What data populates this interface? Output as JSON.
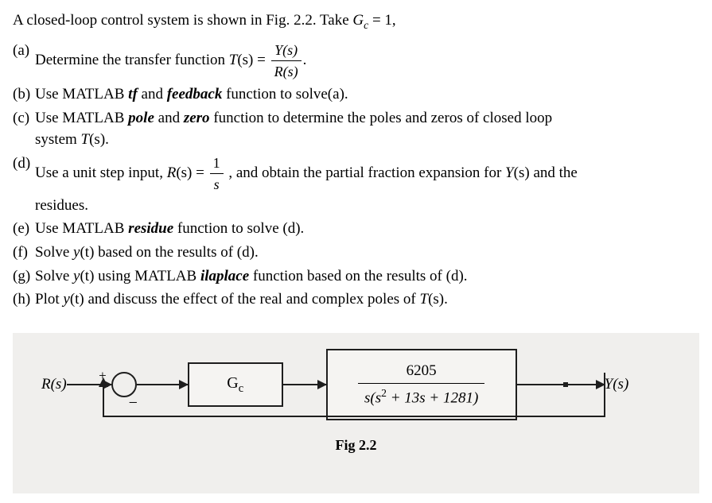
{
  "intro": {
    "pre": "A closed-loop control system is shown in Fig. 2.2. Take ",
    "gc_sym": "G",
    "gc_sub": "c",
    "eq": " = 1,"
  },
  "parts": {
    "a": {
      "label": "(a)",
      "text1": "Determine the transfer function ",
      "T": "T",
      "s_arg": "(s)",
      "eq": " = ",
      "frac_num": "Y(s)",
      "frac_den": "R(s)",
      "dot": "."
    },
    "b": {
      "label": "(b)",
      "text1": "Use MATLAB ",
      "kw1": "tf",
      "and": " and ",
      "kw2": "feedback",
      "text2": " function to solve(a)."
    },
    "c": {
      "label": "(c)",
      "text1": "Use MATLAB ",
      "kw1": "pole",
      "and": " and ",
      "kw2": "zero",
      "text2": " function to determine the poles and zeros of closed loop",
      "text3": "system ",
      "T": "T",
      "s_arg": "(s)."
    },
    "d": {
      "label": "(d)",
      "text1": "Use a unit step input, ",
      "R": "R",
      "s_arg": "(s)",
      "eq": " = ",
      "frac_num": "1",
      "frac_den": "s",
      "comma": " , ",
      "text2": "and obtain the partial fraction expansion for ",
      "Y": "Y",
      "s_arg2": "(s)",
      "text3": " and the",
      "text4": "residues."
    },
    "e": {
      "label": "(e)",
      "text1": "Use MATLAB ",
      "kw1": "residue",
      "text2": " function to solve (d)."
    },
    "f": {
      "label": "(f)",
      "text1": "Solve ",
      "y": "y",
      "t_arg": "(t)",
      "text2": " based on the results of (d)."
    },
    "g": {
      "label": "(g)",
      "text1": "Solve ",
      "y": "y",
      "t_arg": "(t)",
      "text2": " using MATLAB ",
      "kw1": "ilaplace",
      "text3": " function based on the results of (d)."
    },
    "h": {
      "label": "(h)",
      "text1": "Plot ",
      "y": "y",
      "t_arg": "(t)",
      "text2": " and discuss the effect of the real and complex poles of ",
      "T": "T",
      "s_arg": "(s)."
    }
  },
  "diagram": {
    "input": "R(s)",
    "plus": "+",
    "minus": "−",
    "gc_sym": "G",
    "gc_sub": "c",
    "plant_num": "6205",
    "plant_den_pre": "s(s",
    "plant_den_sup": "2",
    "plant_den_post": " + 13s + 1281)",
    "output": "Y(s)",
    "caption": "Fig 2.2"
  }
}
